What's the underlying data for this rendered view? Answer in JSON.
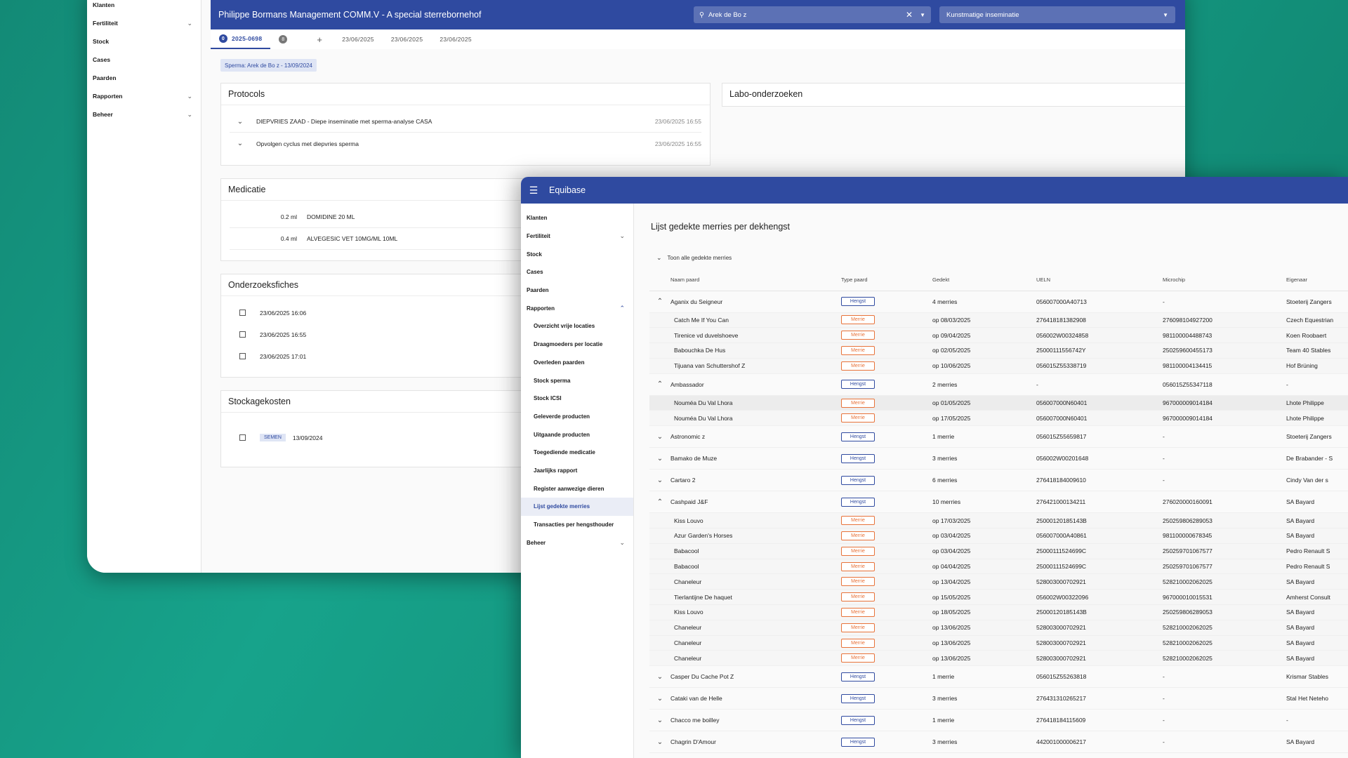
{
  "back": {
    "sidebar": [
      {
        "label": "Klanten",
        "chevron": false
      },
      {
        "label": "Fertiliteit",
        "chevron": true
      },
      {
        "label": "Stock",
        "chevron": false
      },
      {
        "label": "Cases",
        "chevron": false
      },
      {
        "label": "Paarden",
        "chevron": false
      },
      {
        "label": "Rapporten",
        "chevron": true
      },
      {
        "label": "Beheer",
        "chevron": true
      }
    ],
    "title": "Philippe Bormans Management COMM.V - A special sterrebornehof",
    "search_value": "Arek de Bo z",
    "select_value": "Kunstmatige inseminatie",
    "tabs": [
      {
        "badge": "0",
        "label": "2025-0698"
      },
      {
        "badge": "8",
        "label": ""
      },
      {
        "badge": "",
        "label": "+"
      },
      {
        "badge": "",
        "label": "23/06/2025"
      },
      {
        "badge": "",
        "label": "23/06/2025"
      },
      {
        "badge": "",
        "label": "23/06/2025"
      }
    ],
    "chip": "Sperma: Arek de Bo z - 13/09/2024",
    "protocols_title": "Protocols",
    "protocols": [
      {
        "name": "DIEPVRIES ZAAD - Diepe inseminatie met sperma-analyse CASA",
        "ts": "23/06/2025 16:55"
      },
      {
        "name": "Opvolgen cyclus met diepvries sperma",
        "ts": "23/06/2025 16:55"
      }
    ],
    "labo_title": "Labo-onderzoeken",
    "medicatie_title": "Medicatie",
    "medicatie": [
      {
        "dose": "0.2 ml",
        "name": "DOMIDINE 20 ML"
      },
      {
        "dose": "0.4 ml",
        "name": "ALVEGESIC VET 10MG/ML 10ML"
      }
    ],
    "onderzoek_title": "Onderzoeksfiches",
    "onderzoek": [
      "23/06/2025 16:06",
      "23/06/2025 16:55",
      "23/06/2025 17:01"
    ],
    "stockage_title": "Stockagekosten",
    "stockage": {
      "chip": "SEMEN",
      "date": "13/09/2024"
    }
  },
  "front": {
    "app_name": "Equibase",
    "sidebar_top": [
      {
        "label": "Klanten",
        "chevron": ""
      },
      {
        "label": "Fertiliteit",
        "chevron": "v"
      },
      {
        "label": "Stock",
        "chevron": ""
      },
      {
        "label": "Cases",
        "chevron": ""
      },
      {
        "label": "Paarden",
        "chevron": ""
      },
      {
        "label": "Rapporten",
        "chevron": "^"
      }
    ],
    "sidebar_sub": [
      "Overzicht vrije locaties",
      "Draagmoeders per locatie",
      "Overleden paarden",
      "Stock sperma",
      "Stock ICSI",
      "Geleverde producten",
      "Uitgaande producten",
      "Toegediende medicatie",
      "Jaarlijks rapport",
      "Register aanwezige dieren",
      "Lijst gedekte merries",
      "Transacties per hengsthouder"
    ],
    "sidebar_active": "Lijst gedekte merries",
    "sidebar_bottom": {
      "label": "Beheer",
      "chevron": "v"
    },
    "page_title": "Lijst gedekte merries per dekhengst",
    "toggle_all": "Toon alle gedekte merries",
    "columns": [
      "Naam paard",
      "Type paard",
      "Gedekt",
      "UELN",
      "Microchip",
      "Eigenaar"
    ],
    "rows": [
      {
        "kind": "parent",
        "exp": "^",
        "name": "Aganix du Seigneur",
        "type": "Hengst",
        "gedekt": "4 merries",
        "ueln": "056007000A40713",
        "chip": "-",
        "owner": "Stoeterij Zangers"
      },
      {
        "kind": "child",
        "name": "Catch Me If You Can",
        "type": "Merrie",
        "gedekt": "op 08/03/2025",
        "ueln": "276418181382908",
        "chip": "276098104927200",
        "owner": "Czech Equestrian"
      },
      {
        "kind": "child",
        "name": "Tirenice vd duvelshoeve",
        "type": "Merrie",
        "gedekt": "op 09/04/2025",
        "ueln": "056002W00324858",
        "chip": "981100004488743",
        "owner": "Koen Roobaert"
      },
      {
        "kind": "child",
        "name": "Babouchka De Hus",
        "type": "Merrie",
        "gedekt": "op 02/05/2025",
        "ueln": "25000111556742Y",
        "chip": "250259600455173",
        "owner": "Team 40 Stables"
      },
      {
        "kind": "child",
        "name": "Tijuana van Schuttershof Z",
        "type": "Merrie",
        "gedekt": "op 10/06/2025",
        "ueln": "056015Z55338719",
        "chip": "981100004134415",
        "owner": "Hof Brüning"
      },
      {
        "kind": "parent",
        "exp": "^",
        "name": "Ambassador",
        "type": "Hengst",
        "gedekt": "2 merries",
        "ueln": "-",
        "chip": "056015Z55347118",
        "owner": "-"
      },
      {
        "kind": "child",
        "hl": true,
        "name": "Nouméa Du Val Lhora",
        "type": "Merrie",
        "gedekt": "op 01/05/2025",
        "ueln": "056007000N60401",
        "chip": "967000009014184",
        "owner": "Lhote Philippe"
      },
      {
        "kind": "child",
        "name": "Nouméa Du Val Lhora",
        "type": "Merrie",
        "gedekt": "op 17/05/2025",
        "ueln": "056007000N60401",
        "chip": "967000009014184",
        "owner": "Lhote Philippe"
      },
      {
        "kind": "parent",
        "exp": "v",
        "name": "Astronomic z",
        "type": "Hengst",
        "gedekt": "1 merrie",
        "ueln": "056015Z55659817",
        "chip": "-",
        "owner": "Stoeterij Zangers"
      },
      {
        "kind": "parent",
        "exp": "v",
        "name": "Bamako de Muze",
        "type": "Hengst",
        "gedekt": "3 merries",
        "ueln": "056002W00201648",
        "chip": "-",
        "owner": "De Brabander - S"
      },
      {
        "kind": "parent",
        "exp": "v",
        "name": "Cartaro 2",
        "type": "Hengst",
        "gedekt": "6 merries",
        "ueln": "276418184009610",
        "chip": "-",
        "owner": "Cindy Van der s"
      },
      {
        "kind": "parent",
        "exp": "^",
        "name": "Cashpaid J&F",
        "type": "Hengst",
        "gedekt": "10 merries",
        "ueln": "276421000134211",
        "chip": "276020000160091",
        "owner": "SA Bayard"
      },
      {
        "kind": "child",
        "name": "Kiss Louvo",
        "type": "Merrie",
        "gedekt": "op 17/03/2025",
        "ueln": "25000120185143B",
        "chip": "250259806289053",
        "owner": "SA Bayard"
      },
      {
        "kind": "child",
        "name": "Azur Garden's Horses",
        "type": "Merrie",
        "gedekt": "op 03/04/2025",
        "ueln": "056007000A40861",
        "chip": "981100000678345",
        "owner": "SA Bayard"
      },
      {
        "kind": "child",
        "name": "Babacool",
        "type": "Merrie",
        "gedekt": "op 03/04/2025",
        "ueln": "25000111524699C",
        "chip": "250259701067577",
        "owner": "Pedro Renault S"
      },
      {
        "kind": "child",
        "name": "Babacool",
        "type": "Merrie",
        "gedekt": "op 04/04/2025",
        "ueln": "25000111524699C",
        "chip": "250259701067577",
        "owner": "Pedro Renault S"
      },
      {
        "kind": "child",
        "name": "Chaneleur",
        "type": "Merrie",
        "gedekt": "op 13/04/2025",
        "ueln": "528003000702921",
        "chip": "528210002062025",
        "owner": "SA Bayard"
      },
      {
        "kind": "child",
        "name": "Tierlantijne De haquet",
        "type": "Merrie",
        "gedekt": "op 15/05/2025",
        "ueln": "056002W00322096",
        "chip": "967000010015531",
        "owner": "Amherst Consult"
      },
      {
        "kind": "child",
        "name": "Kiss Louvo",
        "type": "Merrie",
        "gedekt": "op 18/05/2025",
        "ueln": "25000120185143B",
        "chip": "250259806289053",
        "owner": "SA Bayard"
      },
      {
        "kind": "child",
        "name": "Chaneleur",
        "type": "Merrie",
        "gedekt": "op 13/06/2025",
        "ueln": "528003000702921",
        "chip": "528210002062025",
        "owner": "SA Bayard"
      },
      {
        "kind": "child",
        "name": "Chaneleur",
        "type": "Merrie",
        "gedekt": "op 13/06/2025",
        "ueln": "528003000702921",
        "chip": "528210002062025",
        "owner": "SA Bayard"
      },
      {
        "kind": "child",
        "name": "Chaneleur",
        "type": "Merrie",
        "gedekt": "op 13/06/2025",
        "ueln": "528003000702921",
        "chip": "528210002062025",
        "owner": "SA Bayard"
      },
      {
        "kind": "parent",
        "exp": "v",
        "name": "Casper Du Cache Pot Z",
        "type": "Hengst",
        "gedekt": "1 merrie",
        "ueln": "056015Z55263818",
        "chip": "-",
        "owner": "Krismar Stables"
      },
      {
        "kind": "parent",
        "exp": "v",
        "name": "Cataki van de Helle",
        "type": "Hengst",
        "gedekt": "3 merries",
        "ueln": "276431310265217",
        "chip": "-",
        "owner": "Stal Het Neteho"
      },
      {
        "kind": "parent",
        "exp": "v",
        "name": "Chacco me boilley",
        "type": "Hengst",
        "gedekt": "1 merrie",
        "ueln": "276418184115609",
        "chip": "-",
        "owner": "-"
      },
      {
        "kind": "parent",
        "exp": "v",
        "name": "Chagrin D'Amour",
        "type": "Hengst",
        "gedekt": "3 merries",
        "ueln": "442001000006217",
        "chip": "-",
        "owner": "SA Bayard"
      }
    ]
  }
}
